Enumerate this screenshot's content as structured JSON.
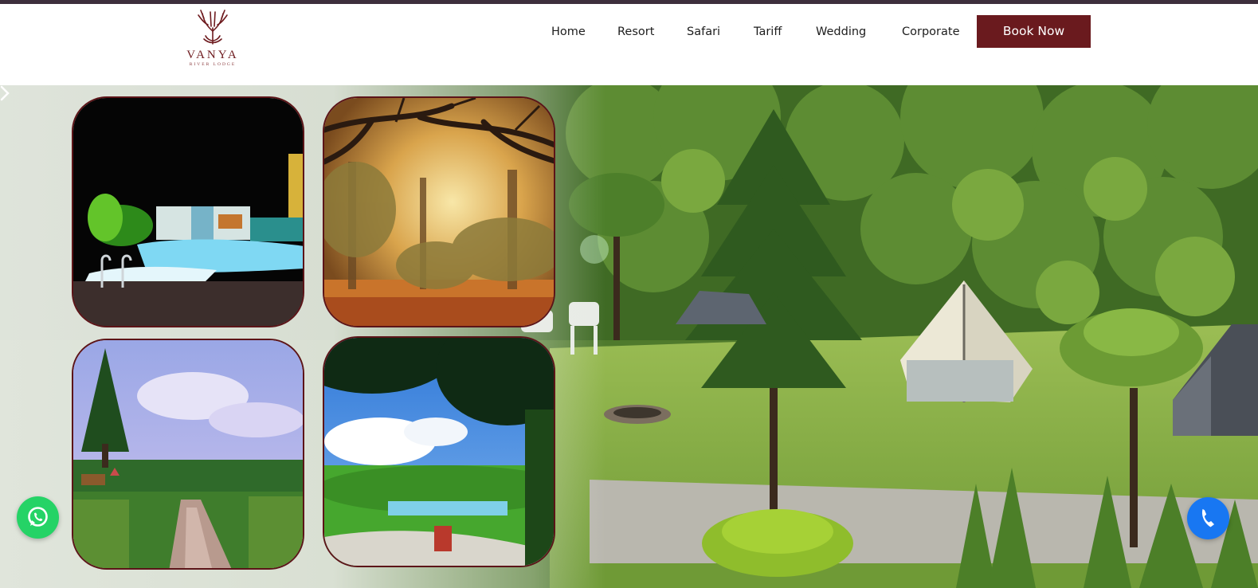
{
  "brand": {
    "name": "VANYA",
    "tagline": "RIVER LODGE"
  },
  "nav": {
    "items": [
      {
        "label": "Home"
      },
      {
        "label": "Resort"
      },
      {
        "label": "Safari"
      },
      {
        "label": "Tariff"
      },
      {
        "label": "Wedding"
      },
      {
        "label": "Corporate"
      }
    ],
    "cta_label": "Book Now"
  },
  "colors": {
    "brand": "#6a1a1e",
    "top_strip": "#3d2f3c",
    "whatsapp": "#25d366",
    "call": "#1877f2"
  },
  "icons": {
    "whatsapp": "whatsapp-icon",
    "call": "phone-icon",
    "next_slide": "chevron-right-icon"
  }
}
